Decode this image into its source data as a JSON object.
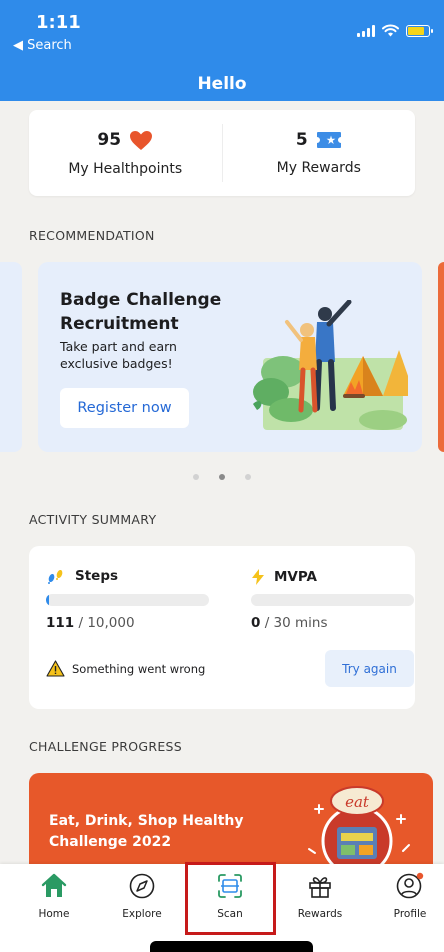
{
  "status_bar": {
    "time": "1:11",
    "back_label": "◀ Search"
  },
  "header": {
    "title": "Hello"
  },
  "summary": {
    "healthpoints_value": "95",
    "healthpoints_label": "My Healthpoints",
    "rewards_value": "5",
    "rewards_label": "My Rewards"
  },
  "recommendation": {
    "section_title": "RECOMMENDATION",
    "card": {
      "title": "Badge Challenge Recruitment",
      "subtitle": "Take part and earn exclusive badges!",
      "button_label": "Register now"
    },
    "active_dot_index": 1,
    "dot_count": 3
  },
  "activity": {
    "section_title": "ACTIVITY SUMMARY",
    "steps": {
      "label": "Steps",
      "current": "111",
      "goal": " / 10,000",
      "progress": 0.011
    },
    "mvpa": {
      "label": "MVPA",
      "current": "0",
      "goal": " / 30 mins",
      "progress": 0
    },
    "error_text": "Something went wrong",
    "retry_label": "Try again"
  },
  "challenge": {
    "section_title": "CHALLENGE PROGRESS",
    "card_title": "Eat, Drink, Shop Healthy Challenge 2022",
    "badge_text": "eat"
  },
  "nav": {
    "items": [
      {
        "label": "Home",
        "icon": "home-icon"
      },
      {
        "label": "Explore",
        "icon": "compass-icon"
      },
      {
        "label": "Scan",
        "icon": "scan-icon"
      },
      {
        "label": "Rewards",
        "icon": "gift-icon"
      },
      {
        "label": "Profile",
        "icon": "profile-icon"
      }
    ]
  },
  "colors": {
    "header_blue": "#2f8bea",
    "accent_red": "#e8552c",
    "home_green": "#2a9a63",
    "challenge_orange": "#e7582a",
    "highlight_red": "#c61a1a"
  }
}
